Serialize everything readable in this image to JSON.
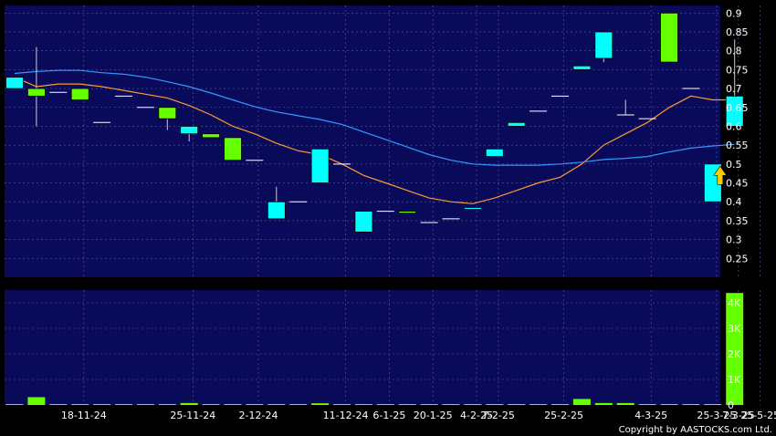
{
  "copyright": "Copyright by AASTOCKS.com Ltd.",
  "colors": {
    "background": "#000000",
    "plot_bg": "#0a0a5a",
    "grid": "#5a5a9a",
    "up": "#00ffff",
    "down": "#66ff00",
    "ma_short": "#ff9933",
    "ma_long": "#3399ff",
    "marker": "#ffcc00"
  },
  "chart_data": {
    "type": "candlestick",
    "price_axis": {
      "ylim": [
        0.2,
        0.92
      ],
      "ticks": [
        0.25,
        0.3,
        0.35,
        0.4,
        0.45,
        0.5,
        0.55,
        0.6,
        0.65,
        0.7,
        0.75,
        0.8,
        0.85,
        0.9
      ],
      "tick_labels": [
        "0.25",
        "0.3",
        "0.35",
        "0.4",
        "0.45",
        "0.5",
        "0.55",
        "0.6",
        "0.65",
        "0.7",
        "0.75",
        "0.8",
        "0.85",
        "0.9"
      ]
    },
    "volume_axis": {
      "ylim": [
        0,
        4500
      ],
      "ticks": [
        0,
        1000,
        2000,
        3000,
        4000
      ],
      "tick_labels": [
        "0",
        "1K",
        "2K",
        "3K",
        "4K"
      ]
    },
    "x_labels": [
      {
        "i": 2,
        "label": "18-11-24"
      },
      {
        "i": 7,
        "label": "25-11-24"
      },
      {
        "i": 10,
        "label": "2-12-24"
      },
      {
        "i": 14,
        "label": "11-12-24"
      },
      {
        "i": 16,
        "label": "6-1-25"
      },
      {
        "i": 18,
        "label": "20-1-25"
      },
      {
        "i": 20,
        "label": "4-2-25"
      },
      {
        "i": 21,
        "label": "7-2-25"
      },
      {
        "i": 24,
        "label": "25-2-25"
      },
      {
        "i": 28,
        "label": "4-3-25"
      },
      {
        "i": 31,
        "label": "25-3-25"
      },
      {
        "i": 32,
        "label": "7-3-25"
      },
      {
        "i": 33,
        "label": "25-5-25"
      }
    ],
    "candles": [
      {
        "open": 0.7,
        "close": 0.73,
        "high": 0.73,
        "low": 0.7
      },
      {
        "open": 0.7,
        "close": 0.68,
        "high": 0.81,
        "low": 0.6
      },
      {
        "open": 0.69,
        "close": 0.69,
        "high": 0.69,
        "low": 0.69
      },
      {
        "open": 0.7,
        "close": 0.67,
        "high": 0.7,
        "low": 0.67
      },
      {
        "open": 0.61,
        "close": 0.61,
        "high": 0.61,
        "low": 0.61
      },
      {
        "open": 0.68,
        "close": 0.68,
        "high": 0.68,
        "low": 0.68
      },
      {
        "open": 0.65,
        "close": 0.65,
        "high": 0.65,
        "low": 0.65
      },
      {
        "open": 0.65,
        "close": 0.62,
        "high": 0.65,
        "low": 0.59
      },
      {
        "open": 0.58,
        "close": 0.6,
        "high": 0.6,
        "low": 0.56
      },
      {
        "open": 0.58,
        "close": 0.57,
        "high": 0.58,
        "low": 0.57
      },
      {
        "open": 0.57,
        "close": 0.51,
        "high": 0.57,
        "low": 0.51
      },
      {
        "open": 0.51,
        "close": 0.51,
        "high": 0.51,
        "low": 0.51
      },
      {
        "open": 0.355,
        "close": 0.4,
        "high": 0.44,
        "low": 0.355
      },
      {
        "open": 0.4,
        "close": 0.4,
        "high": 0.4,
        "low": 0.4
      },
      {
        "open": 0.45,
        "close": 0.54,
        "high": 0.54,
        "low": 0.45
      },
      {
        "open": 0.5,
        "close": 0.5,
        "high": 0.5,
        "low": 0.5
      },
      {
        "open": 0.32,
        "close": 0.375,
        "high": 0.375,
        "low": 0.32
      },
      {
        "open": 0.375,
        "close": 0.375,
        "high": 0.375,
        "low": 0.375
      },
      {
        "open": 0.375,
        "close": 0.37,
        "high": 0.375,
        "low": 0.37
      },
      {
        "open": 0.345,
        "close": 0.345,
        "high": 0.345,
        "low": 0.345
      },
      {
        "open": 0.355,
        "close": 0.355,
        "high": 0.355,
        "low": 0.355
      },
      {
        "open": 0.38,
        "close": 0.385,
        "high": 0.385,
        "low": 0.38
      },
      {
        "open": 0.52,
        "close": 0.54,
        "high": 0.54,
        "low": 0.52
      },
      {
        "open": 0.6,
        "close": 0.61,
        "high": 0.61,
        "low": 0.6
      },
      {
        "open": 0.64,
        "close": 0.64,
        "high": 0.64,
        "low": 0.64
      },
      {
        "open": 0.68,
        "close": 0.68,
        "high": 0.68,
        "low": 0.68
      },
      {
        "open": 0.75,
        "close": 0.76,
        "high": 0.76,
        "low": 0.75
      },
      {
        "open": 0.78,
        "close": 0.85,
        "high": 0.85,
        "low": 0.77
      },
      {
        "open": 0.63,
        "close": 0.63,
        "high": 0.67,
        "low": 0.63
      },
      {
        "open": 0.62,
        "close": 0.62,
        "high": 0.62,
        "low": 0.62
      },
      {
        "open": 0.9,
        "close": 0.77,
        "high": 0.9,
        "low": 0.77
      },
      {
        "open": 0.7,
        "close": 0.7,
        "high": 0.7,
        "low": 0.7
      },
      {
        "open": 0.4,
        "close": 0.5,
        "high": 0.5,
        "low": 0.4
      },
      {
        "open": 0.6,
        "close": 0.68,
        "high": 0.83,
        "low": 0.6
      }
    ],
    "volume": [
      0,
      270,
      0,
      0,
      0,
      0,
      0,
      0,
      40,
      0,
      0,
      0,
      0,
      0,
      30,
      0,
      0,
      0,
      0,
      0,
      0,
      0,
      0,
      0,
      0,
      0,
      200,
      40,
      40,
      0,
      0,
      0,
      0,
      4350
    ],
    "series": [
      {
        "key": "ma_short",
        "values": [
          0.73,
          0.705,
          0.712,
          0.712,
          0.705,
          0.695,
          0.685,
          0.675,
          0.655,
          0.63,
          0.6,
          0.58,
          0.555,
          0.535,
          0.525,
          0.5,
          0.47,
          0.45,
          0.43,
          0.41,
          0.4,
          0.395,
          0.41,
          0.43,
          0.45,
          0.465,
          0.5,
          0.55,
          0.58,
          0.61,
          0.65,
          0.68,
          0.67,
          0.67
        ]
      },
      {
        "key": "ma_long",
        "values": [
          0.74,
          0.745,
          0.748,
          0.748,
          0.742,
          0.738,
          0.73,
          0.718,
          0.705,
          0.688,
          0.67,
          0.652,
          0.638,
          0.628,
          0.618,
          0.605,
          0.585,
          0.565,
          0.545,
          0.525,
          0.51,
          0.5,
          0.497,
          0.497,
          0.497,
          0.5,
          0.505,
          0.512,
          0.515,
          0.52,
          0.532,
          0.542,
          0.548,
          0.552
        ]
      }
    ],
    "marker": {
      "index": 32,
      "price": 0.47,
      "shape": "up-arrow"
    }
  }
}
